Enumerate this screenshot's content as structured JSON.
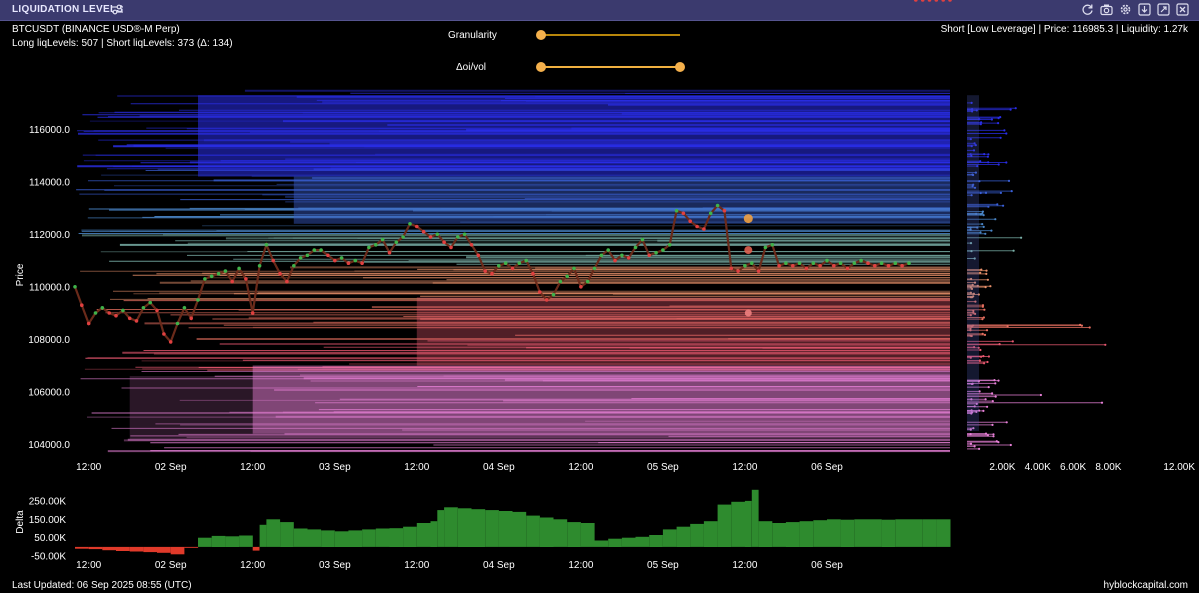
{
  "header": {
    "title": "LIQUIDATION LEVELS",
    "icons": [
      "settings-sliders-icon",
      "refresh-icon",
      "camera-icon",
      "gear-icon",
      "download-icon",
      "expand-icon",
      "close-icon"
    ]
  },
  "info": {
    "symbol": "BTCUSDT (BINANCE USD®-M Perp)",
    "levels": "Long liqLevels: 507 | Short liqLevels: 373 (Δ: 134)",
    "hover": "Short [Low Leverage] | Price: 116985.3 | Liquidity: 1.27k"
  },
  "controls": {
    "granularity_label": "Granularity",
    "granularity_value": 0,
    "ratio_label": "Δoi/vol",
    "ratio_range": [
      0,
      1
    ]
  },
  "footer": {
    "last_updated": "Last Updated: 06 Sep 2025 08:55 (UTC)",
    "brand": "hyblockcapital.com"
  },
  "colors": {
    "bg": "#000000",
    "short_high": "#2a2ee8",
    "short_mid": "#4a86c8",
    "short_low": "#7ab0a8",
    "long_high": "#e8906a",
    "long_mid": "#e85870",
    "long_low": "#e880d8",
    "candle_up": "#3fb24a",
    "candle_down": "#e04040",
    "delta_pos": "#2e8b2e",
    "delta_neg": "#e03a2a",
    "slider": "#f0b040"
  },
  "chart_data": [
    {
      "type": "line",
      "title": "",
      "ylabel": "Price",
      "ylim": [
        103400,
        117500
      ],
      "y_ticks": [
        "104000.0",
        "106000.0",
        "108000.0",
        "110000.0",
        "112000.0",
        "114000.0",
        "116000.0"
      ],
      "x_ticks": [
        "12:00",
        "02 Sep",
        "12:00",
        "03 Sep",
        "12:00",
        "04 Sep",
        "12:00",
        "05 Sep",
        "12:00",
        "06 Sep"
      ],
      "x_hours": [
        12,
        24,
        36,
        48,
        60,
        72,
        84,
        96,
        108,
        120
      ],
      "x_range_hours": [
        10,
        138
      ],
      "series": [
        {
          "x_hours": [
            10,
            11,
            12,
            13,
            14,
            15,
            16,
            17,
            18,
            19,
            20,
            21,
            22,
            23,
            24,
            25,
            26,
            27,
            28,
            29,
            30,
            31,
            32,
            33,
            34,
            35,
            36,
            37,
            38,
            39,
            40,
            41,
            42,
            43,
            44,
            45,
            46,
            47,
            48,
            49,
            50,
            51,
            52,
            53,
            54,
            55,
            56,
            57,
            58,
            59,
            60,
            61,
            62,
            63,
            64,
            65,
            66,
            67,
            68,
            69,
            70,
            71,
            72,
            73,
            74,
            75,
            76,
            77,
            78,
            79,
            80,
            81,
            82,
            83,
            84,
            85,
            86,
            87,
            88,
            89,
            90,
            91,
            92,
            93,
            94,
            95,
            96,
            97,
            98,
            99,
            100,
            101,
            102,
            103,
            104,
            105,
            106,
            107,
            108,
            109,
            110,
            111,
            112,
            113,
            114,
            115,
            116,
            117,
            118,
            119,
            120,
            121,
            122,
            123,
            124,
            125,
            126,
            127,
            128,
            129,
            130,
            131,
            132,
            133,
            134,
            135,
            136,
            137,
            138
          ],
          "values": [
            110000,
            109300,
            108600,
            109000,
            109200,
            109000,
            108900,
            109100,
            108800,
            108700,
            109200,
            109400,
            109100,
            108200,
            107900,
            108600,
            109200,
            108800,
            109500,
            110300,
            110400,
            110500,
            110600,
            110200,
            110700,
            110300,
            109000,
            110800,
            111600,
            111000,
            110500,
            110200,
            110800,
            111100,
            111200,
            111400,
            111400,
            111200,
            111000,
            111100,
            110900,
            111000,
            110900,
            111500,
            111600,
            111800,
            111300,
            111700,
            111900,
            112400,
            112300,
            112100,
            111900,
            112000,
            111700,
            111500,
            111900,
            112000,
            111600,
            111200,
            110600,
            110500,
            110800,
            110900,
            110700,
            110900,
            111000,
            110500,
            109800,
            109500,
            109700,
            110200,
            110400,
            110700,
            110000,
            110200,
            110700,
            111200,
            111400,
            111000,
            111200,
            111100,
            111500,
            111800,
            111200,
            111300,
            111400,
            111600,
            112900,
            112800,
            112500,
            112300,
            112200,
            112800,
            113100,
            112900,
            110700,
            110600,
            110800,
            110900,
            110600,
            111500,
            111600,
            110800,
            110900,
            110800,
            110900,
            110700,
            110900,
            110800,
            111000,
            110800,
            110900,
            110700,
            110900,
            111000,
            110900,
            110800,
            110900,
            110800,
            110900,
            110800,
            110900
          ]
        }
      ]
    },
    {
      "type": "bar",
      "title": "",
      "xlabel": "Liquidity",
      "x_ticks": [
        "2.00K",
        "4.00K",
        "6.00K",
        "8.00K",
        "12.00K"
      ],
      "xlim": [
        0,
        12500
      ]
    },
    {
      "type": "area",
      "title": "",
      "ylabel": "Delta",
      "ylim": [
        -60000,
        320000
      ],
      "y_ticks": [
        "250.00K",
        "150.00K",
        "50.00K",
        "-50.00K"
      ],
      "x_ticks": [
        "12:00",
        "02 Sep",
        "12:00",
        "03 Sep",
        "12:00",
        "04 Sep",
        "12:00",
        "05 Sep",
        "12:00",
        "06 Sep"
      ],
      "x_hours": [
        12,
        24,
        36,
        48,
        60,
        72,
        84,
        96,
        108,
        120
      ],
      "x_hours_values": [
        10,
        12,
        14,
        16,
        18,
        20,
        22,
        24,
        26,
        28,
        30,
        32,
        34,
        36,
        37,
        38,
        40,
        42,
        44,
        46,
        48,
        50,
        52,
        54,
        56,
        58,
        60,
        62,
        63,
        64,
        66,
        68,
        70,
        72,
        74,
        76,
        78,
        80,
        82,
        84,
        86,
        88,
        90,
        92,
        94,
        96,
        98,
        100,
        102,
        104,
        106,
        108,
        109,
        110,
        112,
        114,
        116,
        118,
        120,
        122,
        124,
        126,
        128,
        130,
        132,
        134,
        136,
        138
      ],
      "values": [
        -10000,
        -12000,
        -18000,
        -22000,
        -25000,
        -28000,
        -32000,
        -40000,
        -5000,
        50000,
        60000,
        58000,
        62000,
        -20000,
        120000,
        150000,
        135000,
        100000,
        95000,
        90000,
        85000,
        90000,
        95000,
        100000,
        102000,
        110000,
        130000,
        140000,
        200000,
        215000,
        210000,
        205000,
        200000,
        195000,
        190000,
        170000,
        160000,
        150000,
        135000,
        130000,
        35000,
        45000,
        50000,
        55000,
        65000,
        95000,
        110000,
        125000,
        140000,
        230000,
        245000,
        250000,
        310000,
        140000,
        130000,
        135000,
        140000,
        145000,
        150000,
        148000,
        150000,
        150000,
        148000,
        150000,
        150000,
        150000,
        150000,
        150000
      ]
    }
  ]
}
